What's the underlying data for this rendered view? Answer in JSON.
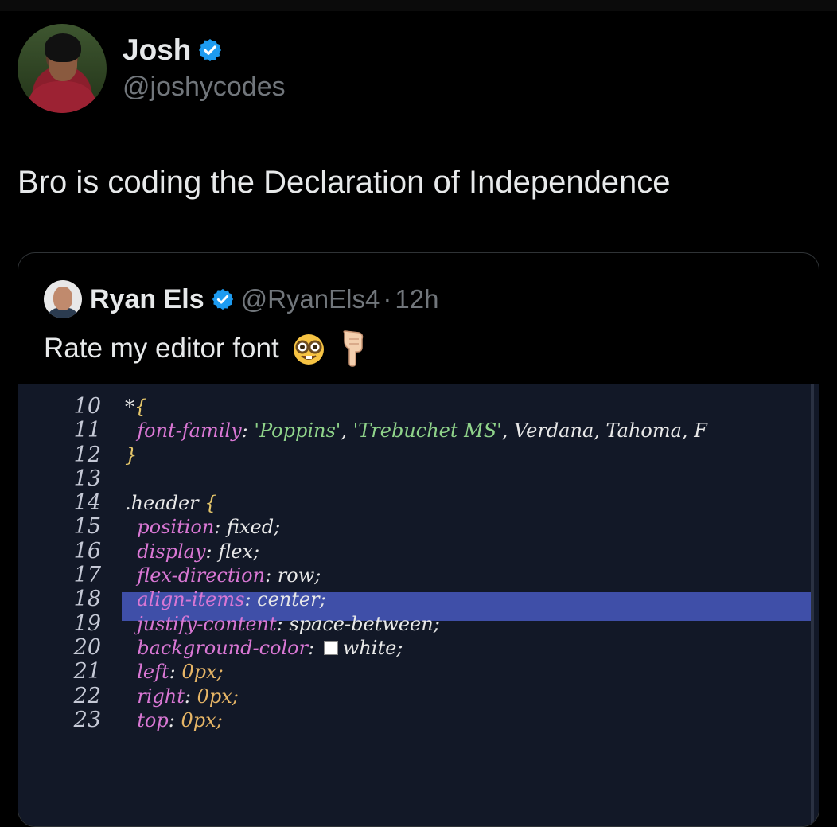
{
  "author": {
    "name": "Josh",
    "handle": "@joshycodes",
    "verified": true
  },
  "tweet": {
    "text": "Bro is coding the Declaration of Independence"
  },
  "quoted": {
    "name": "Ryan Els",
    "handle": "@RyanEls4",
    "separator": "·",
    "time": "12h",
    "text": "Rate my editor font",
    "emojis": [
      "nerd-face",
      "backhand-index-pointing-down"
    ],
    "editor": {
      "line_numbers": [
        "10",
        "11",
        "12",
        "13",
        "14",
        "15",
        "16",
        "17",
        "18",
        "19",
        "20",
        "21",
        "22",
        "23"
      ],
      "highlighted_line": "17",
      "lines": [
        {
          "parts": [
            {
              "t": "*",
              "c": "c-sel"
            },
            {
              "t": "{",
              "c": "c-brace"
            }
          ]
        },
        {
          "parts": [
            {
              "t": "  font-family",
              "c": "c-prop"
            },
            {
              "t": ": ",
              "c": "c-val"
            },
            {
              "t": "'Poppins'",
              "c": "c-str"
            },
            {
              "t": ", ",
              "c": "c-val"
            },
            {
              "t": "'Trebuchet MS'",
              "c": "c-str"
            },
            {
              "t": ", Verdana, Tahoma, F",
              "c": "c-val"
            }
          ]
        },
        {
          "parts": [
            {
              "t": "}",
              "c": "c-brace"
            }
          ]
        },
        {
          "parts": []
        },
        {
          "parts": [
            {
              "t": ".header ",
              "c": "c-sel"
            },
            {
              "t": "{",
              "c": "c-brace"
            }
          ]
        },
        {
          "parts": [
            {
              "t": "  position",
              "c": "c-prop"
            },
            {
              "t": ": fixed;",
              "c": "c-val"
            }
          ]
        },
        {
          "parts": [
            {
              "t": "  display",
              "c": "c-prop"
            },
            {
              "t": ": flex;",
              "c": "c-val"
            }
          ]
        },
        {
          "parts": [
            {
              "t": "  flex-direction",
              "c": "c-prop"
            },
            {
              "t": ": row;",
              "c": "c-val"
            }
          ]
        },
        {
          "parts": [
            {
              "t": "  align-items",
              "c": "c-prop"
            },
            {
              "t": ": center;",
              "c": "c-val"
            }
          ]
        },
        {
          "parts": [
            {
              "t": "  justify-content",
              "c": "c-prop"
            },
            {
              "t": ": space-between;",
              "c": "c-val"
            }
          ]
        },
        {
          "parts": [
            {
              "t": "  background-color",
              "c": "c-prop"
            },
            {
              "t": ": ",
              "c": "c-val"
            },
            {
              "t": "■",
              "c": "swatch"
            },
            {
              "t": "white;",
              "c": "c-val"
            }
          ]
        },
        {
          "parts": [
            {
              "t": "  left",
              "c": "c-prop"
            },
            {
              "t": ": ",
              "c": "c-val"
            },
            {
              "t": "0",
              "c": "c-num"
            },
            {
              "t": "px;",
              "c": "c-num"
            }
          ]
        },
        {
          "parts": [
            {
              "t": "  right",
              "c": "c-prop"
            },
            {
              "t": ": ",
              "c": "c-val"
            },
            {
              "t": "0",
              "c": "c-num"
            },
            {
              "t": "px;",
              "c": "c-num"
            }
          ]
        },
        {
          "parts": [
            {
              "t": "  top",
              "c": "c-prop"
            },
            {
              "t": ": ",
              "c": "c-val"
            },
            {
              "t": "0",
              "c": "c-num"
            },
            {
              "t": "px;",
              "c": "c-num"
            }
          ]
        }
      ]
    }
  },
  "colors": {
    "background": "#000000",
    "verified_badge": "#1d9bf0",
    "secondary_text": "#71767b",
    "editor_bg": "#121827",
    "editor_highlight": "#3f4fa8"
  }
}
